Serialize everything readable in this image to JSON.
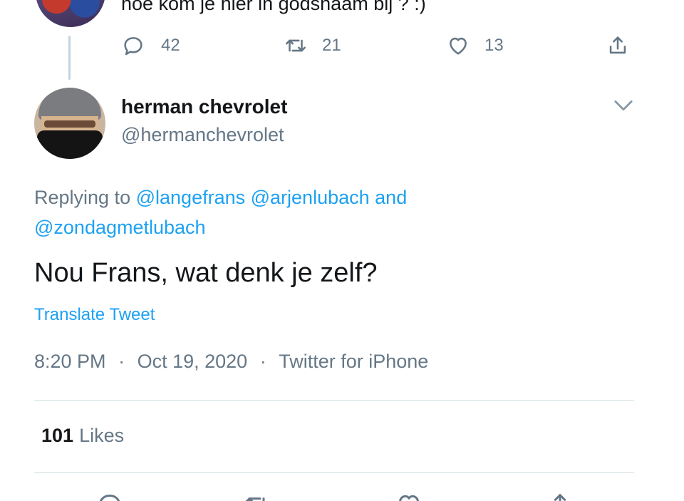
{
  "previous_tweet": {
    "text": "hoe kom je hier in godsnaam bij ? :)",
    "actions": {
      "reply_count": "42",
      "retweet_count": "21",
      "like_count": "13"
    }
  },
  "tweet": {
    "author_name": "herman chevrolet",
    "author_handle": "@hermanchevrolet",
    "replying_prefix": "Replying to",
    "mentions": [
      "@langefrans",
      "@arjenlubach",
      "@zondagmetlubach"
    ],
    "mention_joiner": "and",
    "text": "Nou Frans, wat denk je zelf?",
    "translate_label": "Translate Tweet",
    "time": "8:20 PM",
    "date": "Oct 19, 2020",
    "source": "Twitter for iPhone",
    "separator": "·",
    "likes_count": "101",
    "likes_label": "Likes"
  },
  "icons": {
    "reply": "reply-icon",
    "retweet": "retweet-icon",
    "like": "heart-icon",
    "share": "share-icon",
    "menu": "chevron-down-icon"
  },
  "colors": {
    "link": "#1da1f2",
    "secondary_text": "#657786",
    "primary_text": "#14171a",
    "divider": "#e6ecf0"
  }
}
